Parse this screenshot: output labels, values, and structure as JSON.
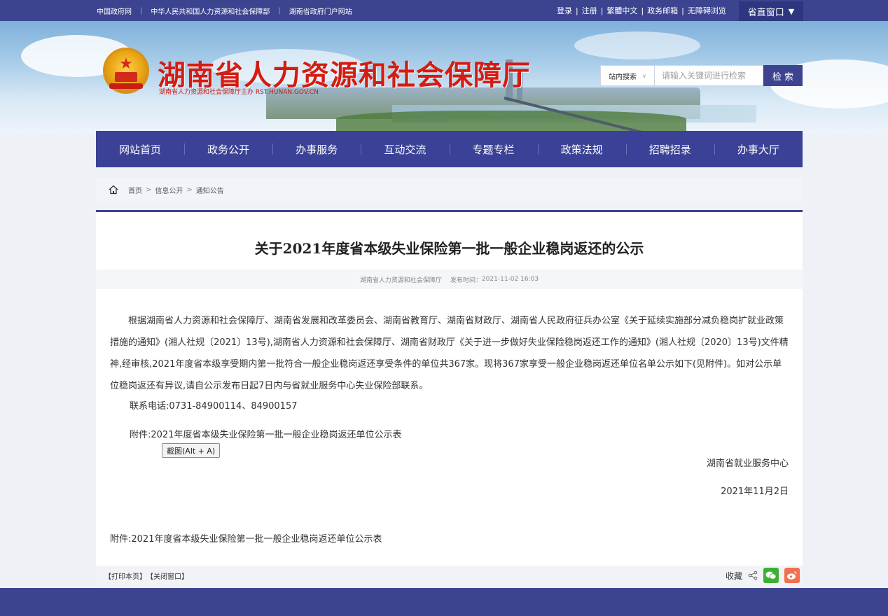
{
  "topbar": {
    "links": [
      "中国政府网",
      "中华人民共和国人力资源和社会保障部",
      "湖南省政府门户网站"
    ],
    "right_links": [
      "登录",
      "注册",
      "繁體中文",
      "政务邮箱",
      "无障碍浏览"
    ],
    "region_label": "省直窗口",
    "region_arrow": "▼"
  },
  "header": {
    "site_title": "湖南省人力资源和社会保障厅",
    "site_subtitle": "湖南省人力资源和社会保障厅主办  RST.HUNAN.GOV.CN",
    "search": {
      "scope_label": "站内搜索",
      "placeholder": "请输入关键词进行检索",
      "button_label": "检 索"
    }
  },
  "nav": {
    "items": [
      "网站首页",
      "政务公开",
      "办事服务",
      "互动交流",
      "专题专栏",
      "政策法规",
      "招聘招录",
      "办事大厅"
    ]
  },
  "breadcrumb": {
    "items": [
      "首页",
      "信息公开",
      "通知公告"
    ],
    "sep": ">"
  },
  "article": {
    "title": "关于2021年度省本级失业保险第一批一般企业稳岗返还的公示",
    "meta_source": "湖南省人力资源和社会保障厅",
    "meta_time_label": "发布时间：",
    "meta_time": "2021-11-02 16:03",
    "body": "根据湖南省人力资源和社会保障厅、湖南省发展和改革委员会、湖南省教育厅、湖南省财政厅、湖南省人民政府征兵办公室《关于延续实施部分减负稳岗扩就业政策措施的通知》(湘人社规〔2021〕13号),湖南省人力资源和社会保障厅、湖南省财政厅《关于进一步做好失业保险稳岗返还工作的通知》(湘人社规〔2020〕13号)文件精神,经审核,2021年度省本级享受期内第一批符合一般企业稳岗返还享受条件的单位共367家。现将367家享受一般企业稳岗返还单位名单公示如下(见附件)。如对公示单位稳岗返还有异议,请自公示发布日起7日内与省就业服务中心失业保险部联系。",
    "contact": "联系电话:0731-84900114、84900157",
    "attachment": "附件:2021年度省本级失业保险第一批一般企业稳岗返还单位公示表",
    "screenshot_tip": "截图(Alt + A)",
    "signature_org": "湖南省就业服务中心",
    "signature_date": "2021年11月2日",
    "attachment_link": "附件:2021年度省本级失业保险第一批一般企业稳岗返还单位公示表"
  },
  "footer_bar": {
    "print": "【打印本页】",
    "close": "【关闭窗口】",
    "favorite": "收藏"
  },
  "colors": {
    "primary": "#3c4490",
    "title_red": "#d41c12",
    "wechat": "#3cb034",
    "weibo": "#f07050"
  }
}
